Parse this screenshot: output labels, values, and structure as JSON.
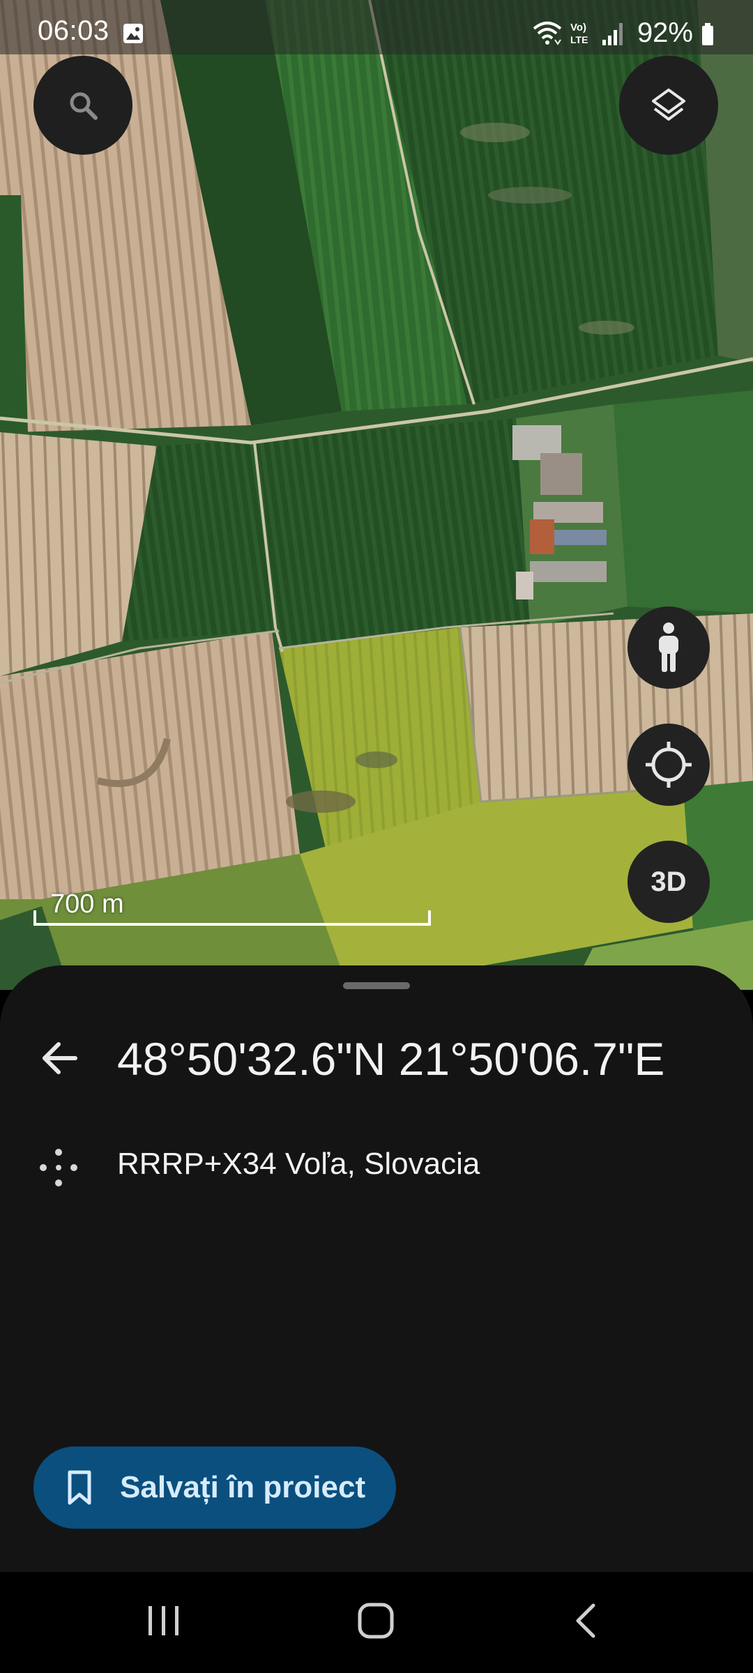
{
  "status_bar": {
    "time": "06:03",
    "battery": "92%",
    "gallery_icon": "image-icon",
    "wifi_icon": "wifi-icon",
    "volte_label": "Vo) LTE",
    "signal_icon": "signal-icon",
    "battery_icon": "battery-icon"
  },
  "map_controls": {
    "search_icon": "search-icon",
    "layers_icon": "layers-icon",
    "pegman_icon": "street-view-icon",
    "locate_icon": "my-location-icon",
    "three_d_label": "3D"
  },
  "map": {
    "scale_label": "700 m"
  },
  "place_sheet": {
    "coordinates": "48°50'32.6\"N 21°50'06.7\"E",
    "plus_code": "RRRP+X34 Voľa, Slovacia",
    "save_label": "Salvați în proiect",
    "back_icon": "arrow-back-icon",
    "plus_code_icon": "plus-code-icon",
    "bookmark_icon": "bookmark-icon",
    "button_color": "#0a4f7e"
  },
  "nav_bar": {
    "recents_icon": "recents-icon",
    "home_icon": "home-icon",
    "back_icon": "back-icon"
  }
}
